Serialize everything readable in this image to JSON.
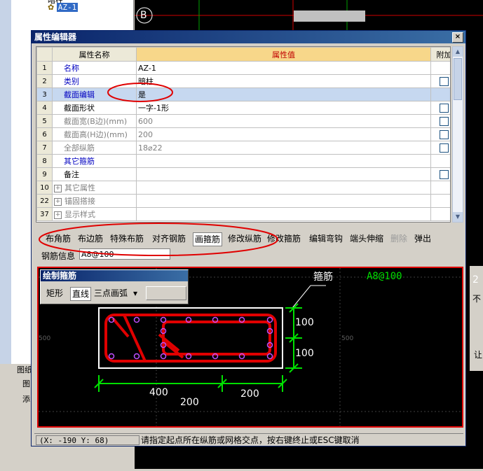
{
  "background": {
    "tree_top_label": "暗柱",
    "tree_node_label": "AZ-1",
    "canvas_axis_label": "B",
    "left_panel_tab1": "图纸",
    "left_panel_tab2": "图",
    "left_panel_tab3": "添",
    "right_panel_label": "不",
    "right_panel_num": "2",
    "right_panel_label2": "让"
  },
  "dialog": {
    "title": "属性编辑器",
    "close_glyph": "×"
  },
  "grid": {
    "headers": {
      "num": "",
      "name": "属性名称",
      "value": "属性值",
      "extra": "附加"
    },
    "rows": [
      {
        "num": "1",
        "name": "名称",
        "value": "AZ-1",
        "style": "blue",
        "check": false,
        "plus": false,
        "selected": false
      },
      {
        "num": "2",
        "name": "类别",
        "value": "暗柱",
        "style": "blue",
        "check": true,
        "plus": false,
        "selected": false
      },
      {
        "num": "3",
        "name": "截面编辑",
        "value": "是",
        "style": "blue",
        "check": false,
        "plus": false,
        "selected": true
      },
      {
        "num": "4",
        "name": "截面形状",
        "value": "一字-1形",
        "style": "black",
        "check": true,
        "plus": false,
        "selected": false
      },
      {
        "num": "5",
        "name": "截面宽(B边)(mm)",
        "value": "600",
        "style": "gray",
        "check": true,
        "plus": false,
        "selected": false
      },
      {
        "num": "6",
        "name": "截面高(H边)(mm)",
        "value": "200",
        "style": "gray",
        "check": true,
        "plus": false,
        "selected": false
      },
      {
        "num": "7",
        "name": "全部纵筋",
        "value": "18⌀22",
        "style": "gray",
        "check": true,
        "plus": false,
        "selected": false
      },
      {
        "num": "8",
        "name": "其它箍筋",
        "value": "",
        "style": "blue",
        "check": false,
        "plus": false,
        "selected": false
      },
      {
        "num": "9",
        "name": "备注",
        "value": "",
        "style": "black",
        "check": true,
        "plus": false,
        "selected": false
      },
      {
        "num": "10",
        "name": "其它属性",
        "value": "",
        "style": "gray",
        "check": false,
        "plus": true,
        "selected": false
      },
      {
        "num": "22",
        "name": "锚固搭接",
        "value": "",
        "style": "gray",
        "check": false,
        "plus": true,
        "selected": false
      },
      {
        "num": "37",
        "name": "显示样式",
        "value": "",
        "style": "gray",
        "check": false,
        "plus": true,
        "selected": false
      }
    ]
  },
  "toolbar": {
    "items": [
      "布角筋",
      "布边筋",
      "特殊布筋",
      "对齐钢筋",
      "画箍筋",
      "修改纵筋",
      "修改箍筋",
      "编辑弯钩",
      "端头伸缩",
      "删除",
      "弹出"
    ],
    "active": "画箍筋",
    "disabled": "删除"
  },
  "rebar_info": {
    "label": "钢筋信息",
    "value": "A8@100"
  },
  "palette": {
    "title": "绘制箍筋",
    "buttons": [
      "矩形",
      "直线",
      "三点画弧"
    ],
    "active": "直线",
    "dropdown_glyph": "▾"
  },
  "drawing": {
    "callout_label": "箍筋",
    "callout_spec": "A8@100",
    "dim_right_top": "100",
    "dim_right_bottom": "100",
    "dim_bottom_left": "400",
    "dim_bottom_mid": "200",
    "dim_bottom_right": "200",
    "grid_label_left": "500",
    "grid_label_right": "500",
    "colors": {
      "rebar": "#e00000",
      "dimension": "#00e000",
      "section": "#ffffff",
      "spec_text": "#00e000",
      "label_text": "#ffffff"
    }
  },
  "status": {
    "coords": "(X: -190 Y: 68)",
    "message": "请指定起点所在纵筋或网格交点，按右键终止或ESC键取消"
  }
}
